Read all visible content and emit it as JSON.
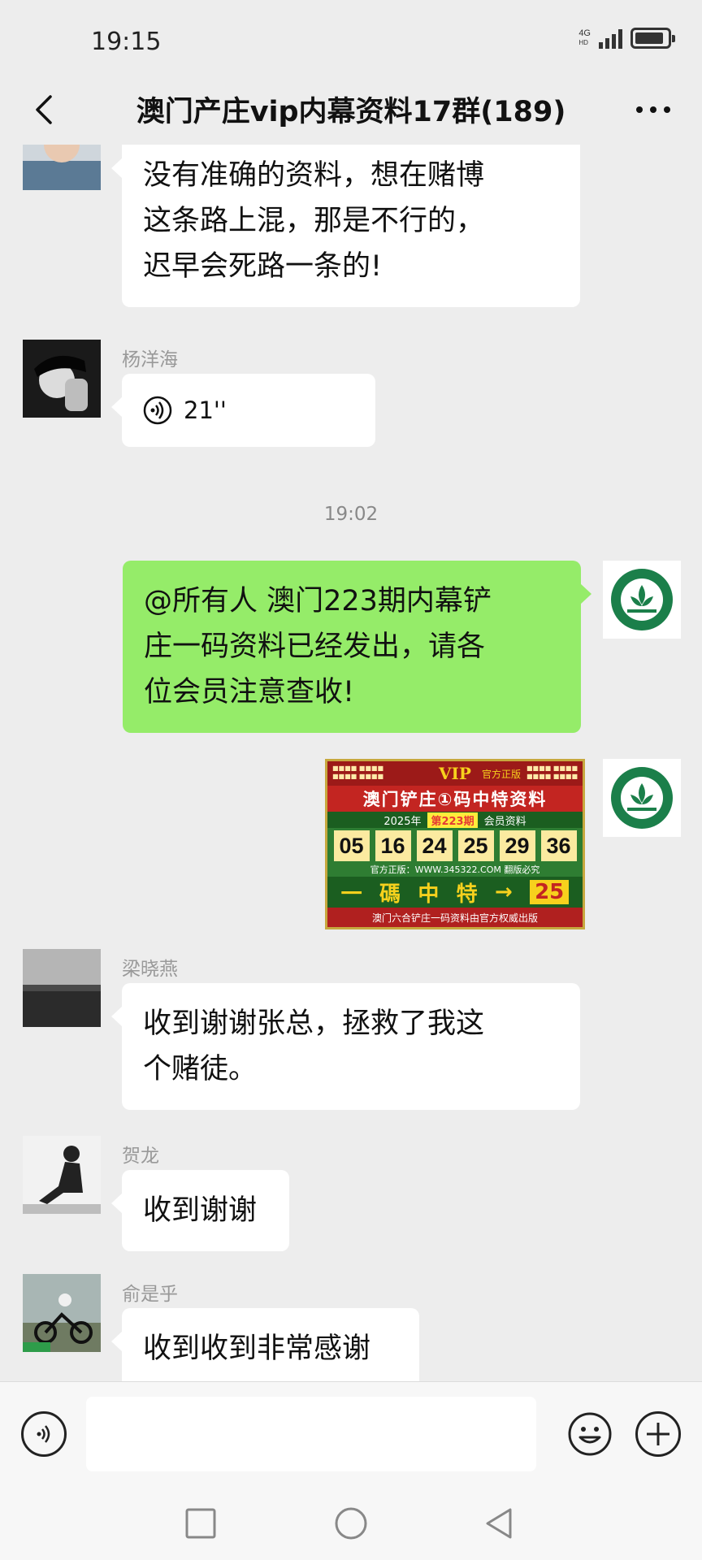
{
  "status_bar": {
    "time": "19:15",
    "network": "4G",
    "network_sub": "HD",
    "battery_level_percent": 90
  },
  "nav": {
    "title": "澳门产庄vip内幕资料17群(189)",
    "back_icon": "chevron-left-icon",
    "more_icon": "more-dots-icon"
  },
  "messages": [
    {
      "id": "m1",
      "side": "left",
      "sender": "",
      "text": "没有准确的资料，想在赌博\n这条路上混，那是不行的，\n迟早会死路一条的!"
    },
    {
      "id": "m2",
      "side": "left",
      "sender": "杨洋海",
      "type": "voice",
      "duration": "21''"
    },
    {
      "id": "ts",
      "type": "timestamp",
      "text": "19:02"
    },
    {
      "id": "m3",
      "side": "right",
      "text": "@所有人 澳门223期内幕铲\n庄一码资料已经发出，请各\n位会员注意查收!"
    },
    {
      "id": "m4",
      "side": "right",
      "type": "image",
      "card": {
        "vip": "VIP",
        "official": "官方正版",
        "title": "澳门铲庄①码中特资料",
        "year": "2025年",
        "issue": "第223期",
        "member": "会员资料",
        "numbers": [
          "05",
          "16",
          "24",
          "25",
          "29",
          "36"
        ],
        "site": "官方正版：WWW.345322.COM 翻版必究",
        "special_label": [
          "一",
          "碼",
          "中",
          "特",
          "→"
        ],
        "special_number": "25",
        "footer": "澳门六合铲庄一码资料由官方权威出版"
      }
    },
    {
      "id": "m5",
      "side": "left",
      "sender": "梁晓燕",
      "text": "收到谢谢张总，拯救了我这\n个赌徒。"
    },
    {
      "id": "m6",
      "side": "left",
      "sender": "贺龙",
      "text": "收到谢谢"
    },
    {
      "id": "m7",
      "side": "left",
      "sender": "俞是乎",
      "text": "收到收到非常感谢"
    }
  ],
  "input_bar": {
    "voice_icon": "voice-icon",
    "emoji_icon": "emoji-icon",
    "plus_icon": "plus-icon",
    "value": ""
  },
  "system_nav": {
    "recent_icon": "square-icon",
    "home_icon": "circle-icon",
    "back_icon": "triangle-back-icon"
  },
  "colors": {
    "background": "#ededed",
    "own_bubble": "#95ec69",
    "other_bubble": "#ffffff"
  }
}
